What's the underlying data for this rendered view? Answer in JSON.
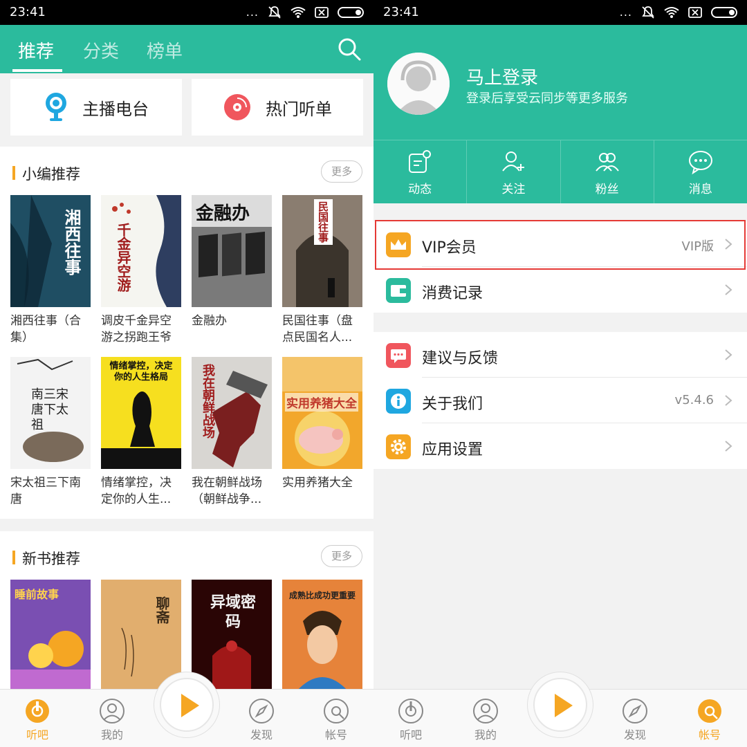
{
  "status": {
    "time": "23:41",
    "dots": "..."
  },
  "left": {
    "tabs": [
      "推荐",
      "分类",
      "榜单"
    ],
    "quick": [
      {
        "label": "主播电台",
        "icon": "microphone-icon"
      },
      {
        "label": "热门听单",
        "icon": "disc-icon"
      }
    ],
    "editor": {
      "title": "小编推荐",
      "more": "更多",
      "books": [
        {
          "title": "湘西往事（合集）",
          "cover_text": "湘西往事",
          "color": "#1f4e63"
        },
        {
          "title": "调皮千金异空游之拐跑王爷",
          "cover_text": "千金异空游",
          "color": "#f5f5f0"
        },
        {
          "title": "金融办",
          "cover_text": "金融办",
          "color": "#7a7a7a"
        },
        {
          "title": "民国往事（盘点民国名人...",
          "cover_text": "民国往事",
          "color": "#6b5e50"
        },
        {
          "title": "宋太祖三下南唐",
          "cover_text": "南三宋唐下太祖",
          "color": "#f3f3f3"
        },
        {
          "title": "情绪掌控，决定你的人生...",
          "cover_text": "情绪掌控，决定你的人生格局",
          "color": "#f6df1f"
        },
        {
          "title": "我在朝鲜战场（朝鲜战争...",
          "cover_text": "我在朝鲜战场",
          "color": "#d8d6d2"
        },
        {
          "title": "实用养猪大全",
          "cover_text": "实用养猪大全",
          "color": "#f2a72c"
        }
      ]
    },
    "newbooks": {
      "title": "新书推荐",
      "more": "更多",
      "books": [
        {
          "cover_text": "睡前故事",
          "color": "#7a4fb2"
        },
        {
          "cover_text": "聊斋",
          "color": "#e1ae6e"
        },
        {
          "cover_text": "异域密码",
          "color": "#5a0d0d"
        },
        {
          "cover_text": "成熟比成功更重要",
          "color": "#e6833a"
        }
      ]
    },
    "nav": [
      {
        "label": "听吧",
        "icon": "listen-icon",
        "active": true
      },
      {
        "label": "我的",
        "icon": "user-icon",
        "active": false
      },
      {
        "label": "发现",
        "icon": "compass-icon",
        "active": false
      },
      {
        "label": "帐号",
        "icon": "account-icon",
        "active": false
      }
    ]
  },
  "right": {
    "login_title": "马上登录",
    "login_sub": "登录后享受云同步等更多服务",
    "stats": [
      {
        "label": "动态",
        "icon": "feed-icon"
      },
      {
        "label": "关注",
        "icon": "follow-icon"
      },
      {
        "label": "粉丝",
        "icon": "fans-icon"
      },
      {
        "label": "消息",
        "icon": "message-icon"
      }
    ],
    "menu1": [
      {
        "label": "VIP会员",
        "value": "VIP版",
        "icon": "crown-icon",
        "color": "#f5a623"
      },
      {
        "label": "消费记录",
        "value": "",
        "icon": "wallet-icon",
        "color": "#2bbb9d"
      }
    ],
    "menu2": [
      {
        "label": "建议与反馈",
        "value": "",
        "icon": "feedback-icon",
        "color": "#f0565d"
      },
      {
        "label": "关于我们",
        "value": "v5.4.6",
        "icon": "info-icon",
        "color": "#1fa7e0"
      },
      {
        "label": "应用设置",
        "value": "",
        "icon": "settings-icon",
        "color": "#f5a623"
      }
    ],
    "nav": [
      {
        "label": "听吧",
        "icon": "listen-icon",
        "active": false
      },
      {
        "label": "我的",
        "icon": "user-icon",
        "active": false
      },
      {
        "label": "发现",
        "icon": "compass-icon",
        "active": false
      },
      {
        "label": "帐号",
        "icon": "account-icon",
        "active": true
      }
    ]
  }
}
